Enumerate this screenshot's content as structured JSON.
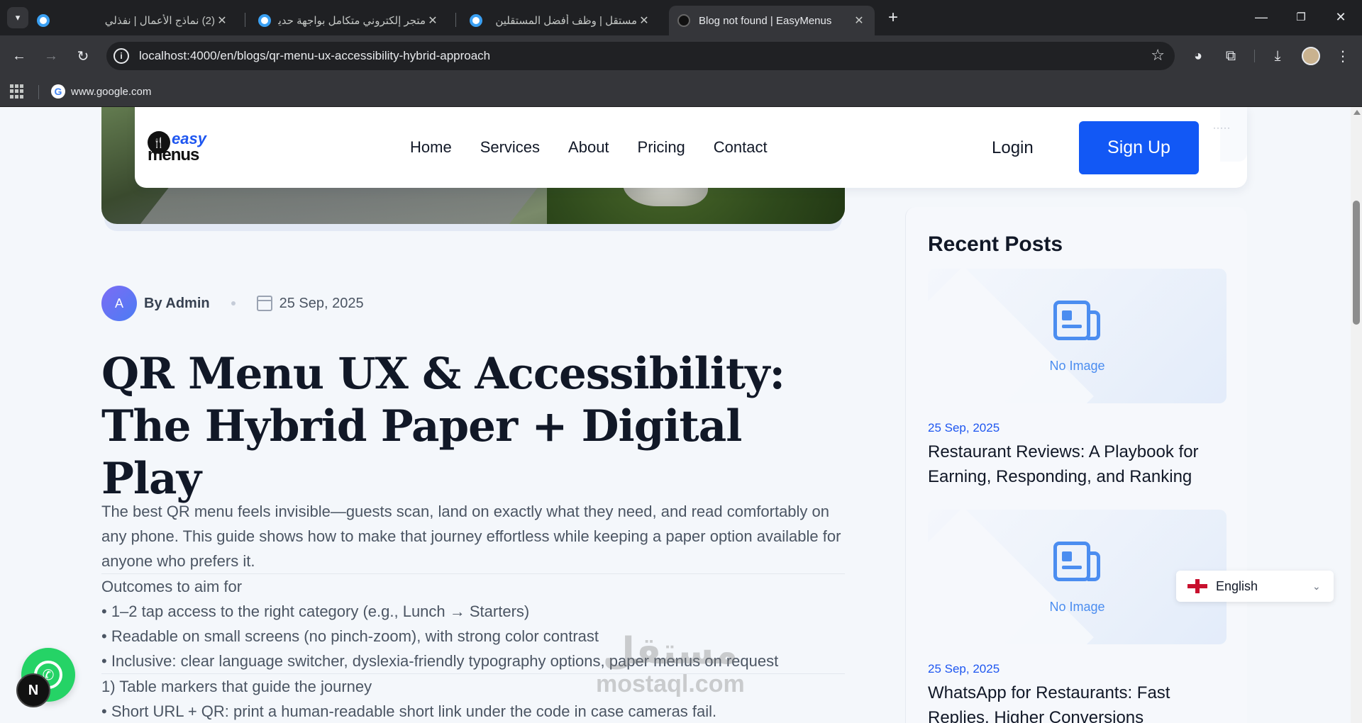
{
  "browser": {
    "tabs": [
      {
        "title": "(2) نماذج الأعمال | نفذلي",
        "icon": "nafzly-favicon"
      },
      {
        "title": "متجر إلكتروني متكامل بواجهة حديثة",
        "icon": "mostaql-favicon"
      },
      {
        "title": "مستقل | وظف أفضل المستقلين",
        "icon": "mostaql-favicon"
      },
      {
        "title": "Blog not found | EasyMenus",
        "icon": "easymenus-favicon",
        "active": true
      }
    ],
    "url": "localhost:4000/en/blogs/qr-menu-ux-accessibility-hybrid-approach",
    "bookmarks": [
      {
        "label": "www.google.com",
        "icon": "google-icon"
      }
    ]
  },
  "header": {
    "logo": {
      "top": "easy",
      "bottom": "menus"
    },
    "nav": [
      "Home",
      "Services",
      "About",
      "Pricing",
      "Contact"
    ],
    "login": "Login",
    "signup": "Sign Up"
  },
  "article": {
    "author_initial": "A",
    "author": "By Admin",
    "date": "25 Sep, 2025",
    "title": "QR Menu UX & Accessibility: The Hybrid Paper + Digital Play",
    "intro": "The best QR menu feels invisible—guests scan, land on exactly what they need, and read comfortably on any phone. This guide shows how to make that journey effortless while keeping a paper option available for anyone who prefers it.",
    "outcomes_heading": "Outcomes to aim for",
    "outcomes": [
      "• 1–2 tap access to the right category (e.g., Lunch → Starters)",
      "• Readable on small screens (no pinch-zoom), with strong color contrast",
      "• Inclusive: clear language switcher, dyslexia-friendly typography options, paper menus on request"
    ],
    "section1_heading": "1) Table markers that guide the journey",
    "section1_items": [
      "• Short URL + QR: print a human-readable short link under the code in case cameras fail."
    ]
  },
  "sidebar": {
    "title": "Recent Posts",
    "posts": [
      {
        "image_label": "No Image",
        "date": "25 Sep, 2025",
        "title": "Restaurant Reviews: A Playbook for Earning, Responding, and Ranking"
      },
      {
        "image_label": "No Image",
        "date": "25 Sep, 2025",
        "title": "WhatsApp for Restaurants: Fast Replies, Higher Conversions"
      }
    ]
  },
  "language": {
    "selected": "English"
  },
  "floating": {
    "next_badge": "N"
  },
  "watermark": {
    "ar": "مستقل",
    "en": "mostaql.com"
  },
  "colors": {
    "primary": "#1258f5",
    "whatsapp": "#25d366",
    "link_date": "#1e56f0"
  }
}
